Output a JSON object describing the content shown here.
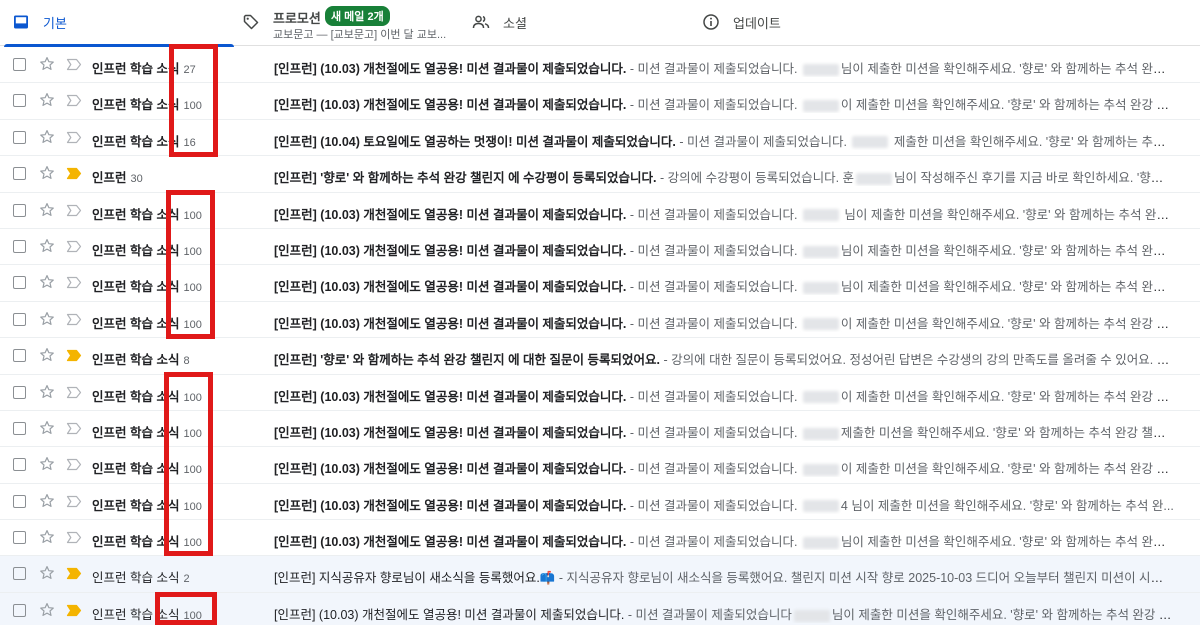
{
  "tabs": {
    "primary": {
      "label": "기본"
    },
    "promotions": {
      "label": "프로모션",
      "badge": "새 메일 2개",
      "subtitle": "교보문고 — [교보문고] 이번 달 교보..."
    },
    "social": {
      "label": "소셜"
    },
    "updates": {
      "label": "업데이트"
    }
  },
  "colors": {
    "accent": "#0b57d0",
    "badge": "#188038",
    "highlight": "#e01919",
    "important_marker": "#f4b400"
  },
  "rows": [
    {
      "sender": "인프런 학습 소식",
      "count": "27",
      "subject": "[인프런] (10.03) 개천절에도 열공용! 미션 결과물이 제출되었습니다.",
      "snippet_a": " - 미션 결과물이 제출되었습니다. ",
      "snippet_b": "님이 제출한 미션을 확인해주세요. '향로' 와 함께하는 추석 완강 챌린...",
      "important": false,
      "read": false
    },
    {
      "sender": "인프런 학습 소식",
      "count": "100",
      "subject": "[인프런] (10.03) 개천절에도 열공용! 미션 결과물이 제출되었습니다.",
      "snippet_a": " - 미션 결과물이 제출되었습니다. ",
      "snippet_b": "이 제출한 미션을 확인해주세요. '향로' 와 함께하는 추석 완강 챌...",
      "important": false,
      "read": false
    },
    {
      "sender": "인프런 학습 소식",
      "count": "16",
      "subject": "[인프런] (10.04) 토요일에도 열공하는 멋쟁이! 미션 결과물이 제출되었습니다.",
      "snippet_a": " - 미션 결과물이 제출되었습니다. ",
      "snippet_b": " 제출한 미션을 확인해주세요. '향로' 와 함께하는 추석...",
      "important": false,
      "read": false
    },
    {
      "sender": "인프런",
      "count": "30",
      "subject": "[인프런] '향로' 와 함께하는 추석 완강 챌린지 에 수강평이 등록되었습니다.",
      "snippet_a": " - 강의에 수강평이 등록되었습니다. 훈",
      "snippet_b": "님이 작성해주신 후기를 지금 바로 확인하세요. '향로' ...",
      "important": true,
      "read": false
    },
    {
      "sender": "인프런 학습 소식",
      "count": "100",
      "subject": "[인프런] (10.03) 개천절에도 열공용! 미션 결과물이 제출되었습니다.",
      "snippet_a": " - 미션 결과물이 제출되었습니다. ",
      "snippet_b": " 님이 제출한 미션을 확인해주세요. '향로' 와 함께하는 추석 완강 챌...",
      "important": false,
      "read": false
    },
    {
      "sender": "인프런 학습 소식",
      "count": "100",
      "subject": "[인프런] (10.03) 개천절에도 열공용! 미션 결과물이 제출되었습니다.",
      "snippet_a": " - 미션 결과물이 제출되었습니다. ",
      "snippet_b": "님이 제출한 미션을 확인해주세요. '향로' 와 함께하는 추석 완강 챌...",
      "important": false,
      "read": false
    },
    {
      "sender": "인프런 학습 소식",
      "count": "100",
      "subject": "[인프런] (10.03) 개천절에도 열공용! 미션 결과물이 제출되었습니다.",
      "snippet_a": " - 미션 결과물이 제출되었습니다. ",
      "snippet_b": "님이 제출한 미션을 확인해주세요. '향로' 와 함께하는 추석 완강 챌...",
      "important": false,
      "read": false
    },
    {
      "sender": "인프런 학습 소식",
      "count": "100",
      "subject": "[인프런] (10.03) 개천절에도 열공용! 미션 결과물이 제출되었습니다.",
      "snippet_a": " - 미션 결과물이 제출되었습니다. ",
      "snippet_b": "이 제출한 미션을 확인해주세요. '향로' 와 함께하는 추석 완강 챌린...",
      "important": false,
      "read": false
    },
    {
      "sender": "인프런 학습 소식",
      "count": "8",
      "subject": "[인프런] '향로' 와 함께하는 추석 완강 챌린지 에 대한 질문이 등록되었어요.",
      "snippet_a": " - 강의에 대한 질문이 등록되었어요. 정성어린 답변은 수강생의 강의 만족도를 올려줄 수 있어요. 지금, ...",
      "snippet_b": "",
      "important": true,
      "read": false
    },
    {
      "sender": "인프런 학습 소식",
      "count": "100",
      "subject": "[인프런] (10.03) 개천절에도 열공용! 미션 결과물이 제출되었습니다.",
      "snippet_a": " - 미션 결과물이 제출되었습니다. ",
      "snippet_b": "이 제출한 미션을 확인해주세요. '향로' 와 함께하는 추석 완강 챌...",
      "important": false,
      "read": false
    },
    {
      "sender": "인프런 학습 소식",
      "count": "100",
      "subject": "[인프런] (10.03) 개천절에도 열공용! 미션 결과물이 제출되었습니다.",
      "snippet_a": " - 미션 결과물이 제출되었습니다. ",
      "snippet_b": "제출한 미션을 확인해주세요. '향로' 와 함께하는 추석 완강 챌린...",
      "important": false,
      "read": false
    },
    {
      "sender": "인프런 학습 소식",
      "count": "100",
      "subject": "[인프런] (10.03) 개천절에도 열공용! 미션 결과물이 제출되었습니다.",
      "snippet_a": " - 미션 결과물이 제출되었습니다. ",
      "snippet_b": "이 제출한 미션을 확인해주세요. '향로' 와 함께하는 추석 완강 챌...",
      "important": false,
      "read": false
    },
    {
      "sender": "인프런 학습 소식",
      "count": "100",
      "subject": "[인프런] (10.03) 개천절에도 열공용! 미션 결과물이 제출되었습니다.",
      "snippet_a": " - 미션 결과물이 제출되었습니다. ",
      "snippet_b": "4 님이 제출한 미션을 확인해주세요. '향로' 와 함께하는 추석 완...",
      "important": false,
      "read": false
    },
    {
      "sender": "인프런 학습 소식",
      "count": "100",
      "subject": "[인프런] (10.03) 개천절에도 열공용! 미션 결과물이 제출되었습니다.",
      "snippet_a": " - 미션 결과물이 제출되었습니다. ",
      "snippet_b": "님이 제출한 미션을 확인해주세요. '향로' 와 함께하는 추석 완강 챌...",
      "important": false,
      "read": false
    },
    {
      "sender": "인프런 학습 소식",
      "count": "2",
      "subject": "[인프런] 지식공유자 향로님이 새소식을 등록했어요.📫",
      "snippet_a": " - 지식공유자 향로님이 새소식을 등록했어요. 챌린지 미션 시작 향로 2025-10-03 드디어 오늘부터 챌린지 미션이 시작되었...",
      "snippet_b": "",
      "important": true,
      "read": true
    },
    {
      "sender": "인프런 학습 소식",
      "count": "100",
      "subject": "[인프런] (10.03) 개천절에도 열공용! 미션 결과물이 제출되었습니다.",
      "snippet_a": " - 미션 결과물이 제출되었습니다",
      "snippet_b": "님이 제출한 미션을 확인해주세요. '향로' 와 함께하는 추석 완강 챌...",
      "important": true,
      "read": true
    }
  ]
}
